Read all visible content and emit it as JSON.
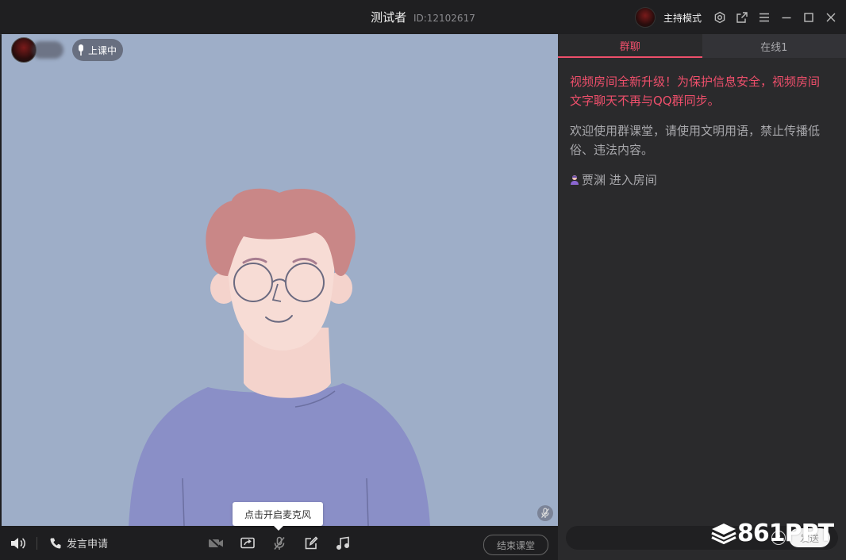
{
  "titlebar": {
    "title": "测试者",
    "user_id": "ID:12102617",
    "mode_label": "主持模式",
    "icons": [
      "settings-icon",
      "external-link-icon",
      "menu-icon",
      "minimize-icon",
      "maximize-icon",
      "close-icon"
    ]
  },
  "video": {
    "status_badge": "上课中",
    "mic_tooltip": "点击开启麦克风"
  },
  "toolbar": {
    "speak_request": "发言申请",
    "end_class": "结束课堂",
    "icons": [
      "speaker-icon",
      "phone-icon",
      "camera-off-icon",
      "screen-share-icon",
      "mic-off-icon",
      "whiteboard-icon",
      "music-icon"
    ]
  },
  "panel": {
    "tabs": [
      {
        "label": "群聊",
        "active": true
      },
      {
        "label": "在线1",
        "active": false
      }
    ],
    "messages": {
      "system_notice": "视频房间全新升级！为保护信息安全，视频房间文字聊天不再与QQ群同步。",
      "welcome": "欢迎使用群课堂，请使用文明用语，禁止传播低俗、违法内容。",
      "join_event": "贾渊 进入房间"
    },
    "send_label": "发送"
  },
  "watermark": "861PPT",
  "colors": {
    "accent": "#ee4f6b",
    "video_bg": "#9eaec8",
    "panel_bg": "#2a2a2c",
    "titlebar_bg": "#1f1f21"
  }
}
